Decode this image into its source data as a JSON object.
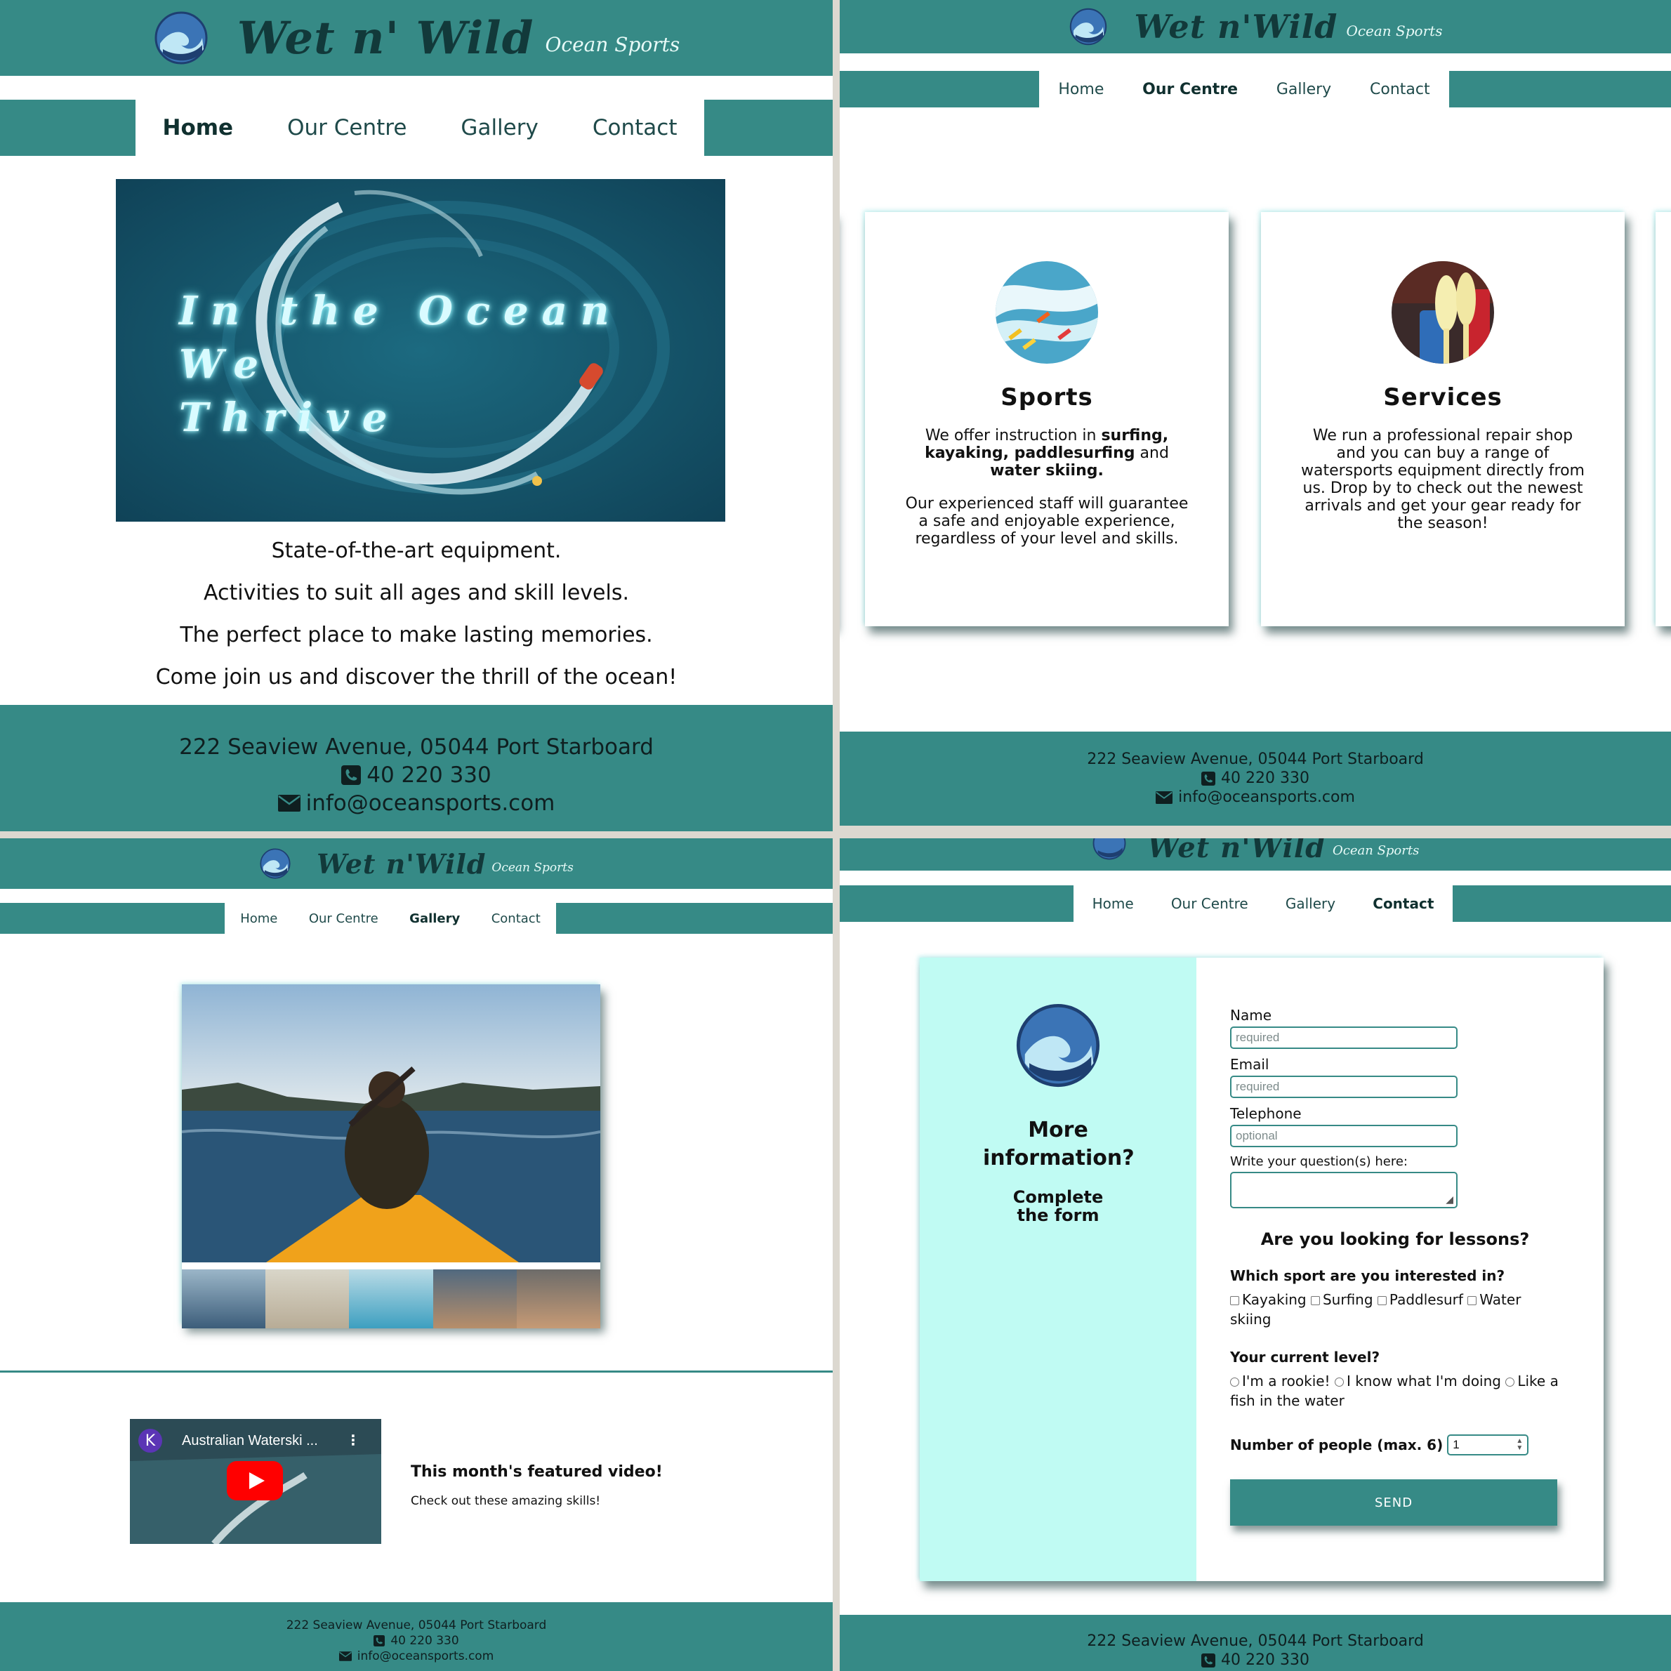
{
  "brand": {
    "name": "Wet n' Wild",
    "tagline": "Ocean Sports",
    "small_name": "Wet n'Wild"
  },
  "colors": {
    "teal": "#368a86",
    "dark_text": "#12393a",
    "mint": "#c0fbf3",
    "button": "#368a86"
  },
  "nav": {
    "home": "Home",
    "centre": "Our Centre",
    "gallery": "Gallery",
    "contact": "Contact"
  },
  "home": {
    "hero_heading": "In the Ocean We Thrive",
    "hero_line1": "In the Ocean We",
    "hero_line2": "Thrive",
    "lines": [
      "State-of-the-art equipment.",
      "Activities to suit all ages and skill levels.",
      "The perfect place to make lasting memories.",
      "Come join us and discover the thrill of the ocean!"
    ]
  },
  "centre": {
    "sports_title": "Sports",
    "sports_p1_pre": "We offer instruction in ",
    "sports_p1_b1": "surfing, kayaking, paddlesurfing",
    "sports_p1_mid": " and ",
    "sports_p1_b2": "water skiing.",
    "sports_p2": "Our experienced staff will guarantee a safe and enjoyable experience, regardless of your level and skills.",
    "services_title": "Services",
    "services_p": "We run a professional repair shop and you can buy a range of watersports equipment directly from us. Drop by to check out the newest arrivals and get your gear ready for the season!"
  },
  "gallery": {
    "video_channel_initial": "K",
    "video_title": "Australian Waterski ...",
    "featured_title": "This month's featured video!",
    "featured_sub": "Check out these amazing skills!"
  },
  "contact": {
    "side_title": "More information?",
    "side_sub": "Complete the form",
    "name_label": "Name",
    "name_placeholder": "required",
    "email_label": "Email",
    "email_placeholder": "required",
    "tel_label": "Telephone",
    "tel_placeholder": "optional",
    "question_label": "Write your question(s) here:",
    "lessons_heading": "Are you looking for lessons?",
    "sport_question": "Which sport are you interested in?",
    "sports": [
      "Kayaking",
      "Surfing",
      "Paddlesurf",
      "Water skiing"
    ],
    "level_question": "Your current level?",
    "levels": [
      "I'm a rookie!",
      "I know what I'm doing",
      "Like a fish in the water"
    ],
    "people_label": "Number of people (max. 6)",
    "people_value": "1",
    "send_label": "SEND"
  },
  "footer": {
    "address": "222 Seaview Avenue, 05044 Port Starboard",
    "phone": "40 220 330",
    "email": "info@oceansports.com"
  },
  "icons": [
    "wave-logo-icon",
    "phone-icon",
    "envelope-icon",
    "youtube-play-icon",
    "kebab-menu-icon"
  ]
}
